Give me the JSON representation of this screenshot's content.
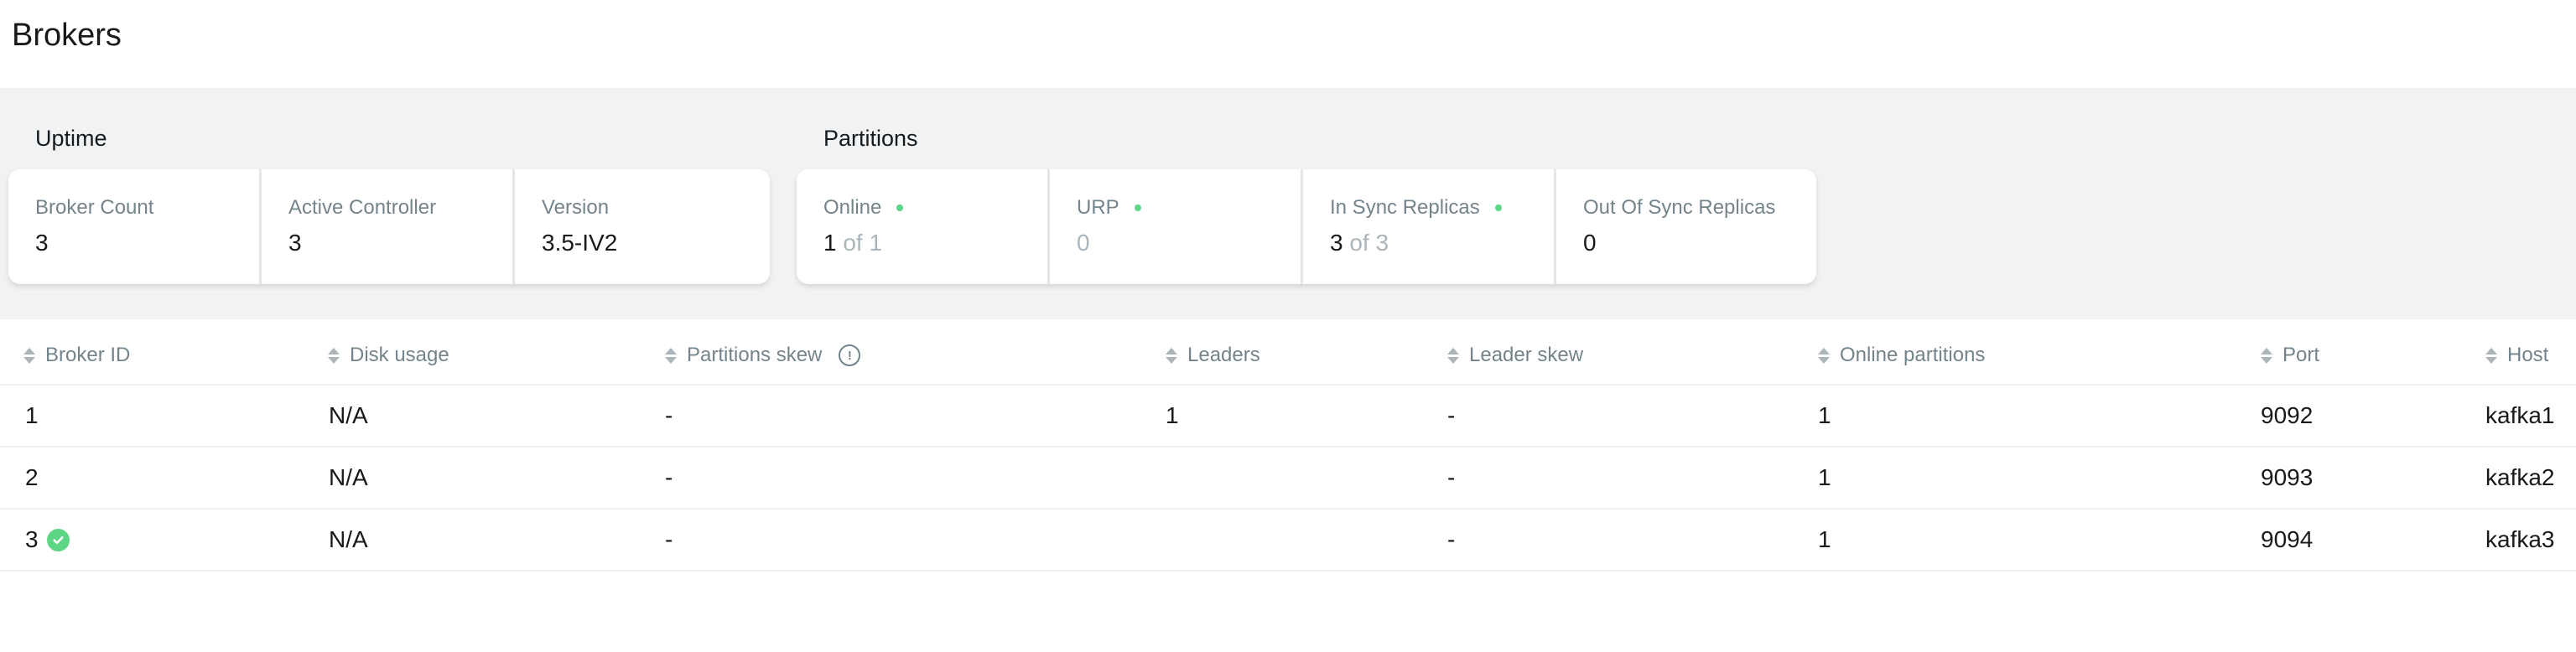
{
  "page": {
    "title": "Brokers"
  },
  "uptime": {
    "title": "Uptime",
    "cards": [
      {
        "label": "Broker Count",
        "value": "3"
      },
      {
        "label": "Active Controller",
        "value": "3"
      },
      {
        "label": "Version",
        "value": "3.5-IV2"
      }
    ]
  },
  "partitions": {
    "title": "Partitions",
    "cards": [
      {
        "label": "Online",
        "value": "1",
        "suffix": "of 1",
        "status": "ok"
      },
      {
        "label": "URP",
        "value": "0",
        "status": "ok"
      },
      {
        "label": "In Sync Replicas",
        "value": "3",
        "suffix": "of 3",
        "status": "ok"
      },
      {
        "label": "Out Of Sync Replicas",
        "value": "0"
      }
    ]
  },
  "colors": {
    "ok": "#5cd685",
    "muted": "#abb5ba",
    "label": "#73848c"
  },
  "table": {
    "columns": [
      "Broker ID",
      "Disk usage",
      "Partitions skew",
      "Leaders",
      "Leader skew",
      "Online partitions",
      "Port",
      "Host"
    ],
    "rows": [
      {
        "broker_id": "1",
        "disk_usage": "N/A",
        "partitions_skew": "-",
        "leaders": "1",
        "leader_skew": "-",
        "online_partitions": "1",
        "port": "9092",
        "host": "kafka1"
      },
      {
        "broker_id": "2",
        "disk_usage": "N/A",
        "partitions_skew": "-",
        "leaders": "",
        "leader_skew": "-",
        "online_partitions": "1",
        "port": "9093",
        "host": "kafka2"
      },
      {
        "broker_id": "3",
        "disk_usage": "N/A",
        "partitions_skew": "-",
        "leaders": "",
        "leader_skew": "-",
        "online_partitions": "1",
        "port": "9094",
        "host": "kafka3",
        "controller_icon": "check-circle-icon"
      }
    ]
  }
}
